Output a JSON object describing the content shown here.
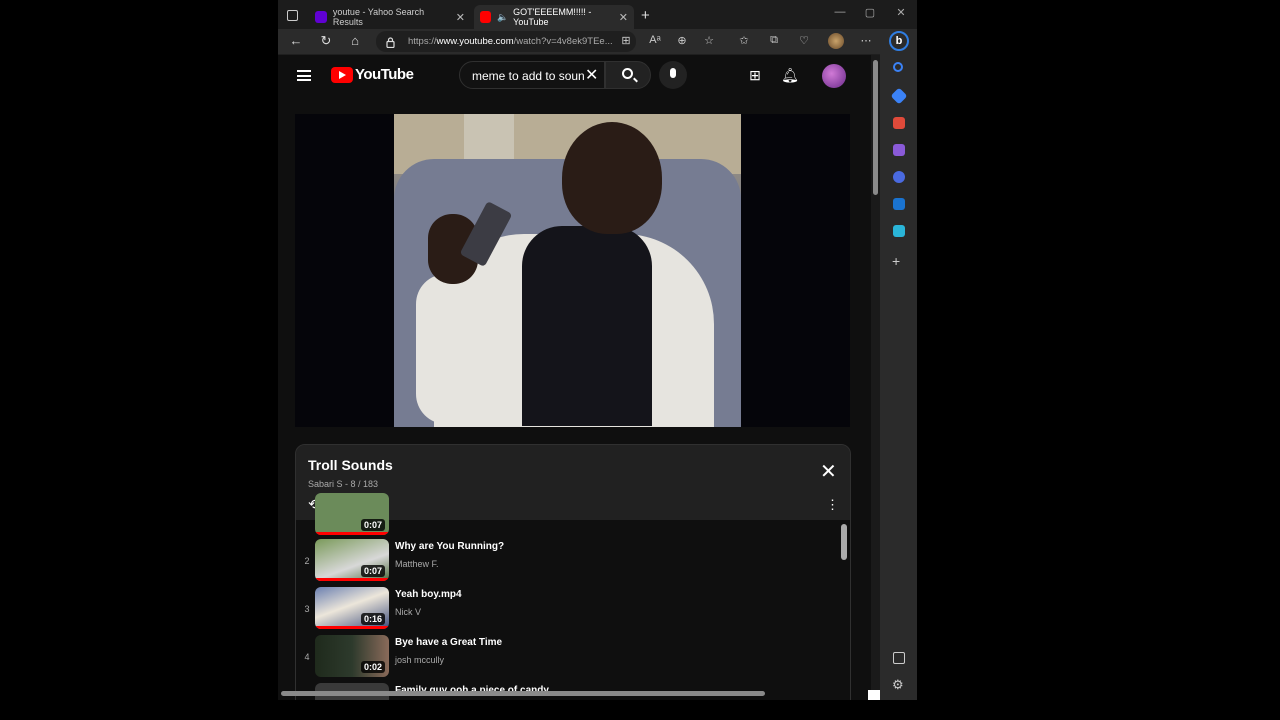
{
  "browser": {
    "tabs": [
      {
        "title": "youtue - Yahoo Search Results",
        "favicon_color": "#6001d2",
        "active": false
      },
      {
        "title": "GOT'EEEEMM!!!!! - YouTube",
        "favicon_color": "#ff0000",
        "active": true
      }
    ],
    "new_tab_label": "+",
    "url_prefix": "https://",
    "url_domain": "www.youtube.com",
    "url_path": "/watch?v=4v8ek9TEe..."
  },
  "youtube": {
    "logo_text": "YouTube",
    "search_query": "meme to add to soun",
    "accent_color": "#ff0000"
  },
  "playlist": {
    "title": "Troll Sounds",
    "subtitle": "Sabari S - 8 / 183",
    "items": [
      {
        "index": "",
        "name": "",
        "channel": "",
        "duration": "0:07",
        "thumb_color": "#6b8b5a",
        "progress": 1.0
      },
      {
        "index": "2",
        "name": "Why are You Running?",
        "channel": "Matthew F.",
        "duration": "0:07",
        "thumb_color": "#5f7d4a",
        "progress": 1.0
      },
      {
        "index": "3",
        "name": "Yeah boy.mp4",
        "channel": "Nick V",
        "duration": "0:16",
        "thumb_color": "#4a5d8a",
        "progress": 1.0
      },
      {
        "index": "4",
        "name": "Bye have a Great Time",
        "channel": "josh mccully",
        "duration": "0:02",
        "thumb_color": "#2d3a2c",
        "progress": 0
      },
      {
        "index": "",
        "name": "Family guy ooh a piece of candy",
        "channel": "",
        "duration": "",
        "thumb_color": "#3a3a3a",
        "progress": 0
      }
    ]
  }
}
